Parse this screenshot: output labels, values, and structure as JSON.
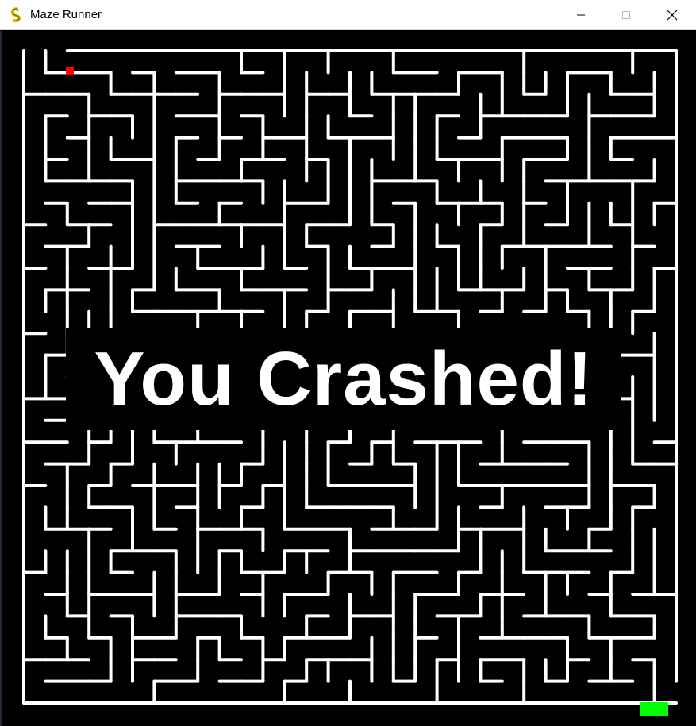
{
  "window": {
    "title": "Maze Runner",
    "icon": "pygame-snake-icon",
    "controls": [
      "minimize-icon",
      "maximize-icon",
      "close-icon"
    ]
  },
  "game": {
    "message": "You Crashed!",
    "colors": {
      "background": "#000000",
      "walls": "#ffffff",
      "player": "#ff0000",
      "goal": "#00ff00",
      "message": "#ffffff"
    }
  }
}
